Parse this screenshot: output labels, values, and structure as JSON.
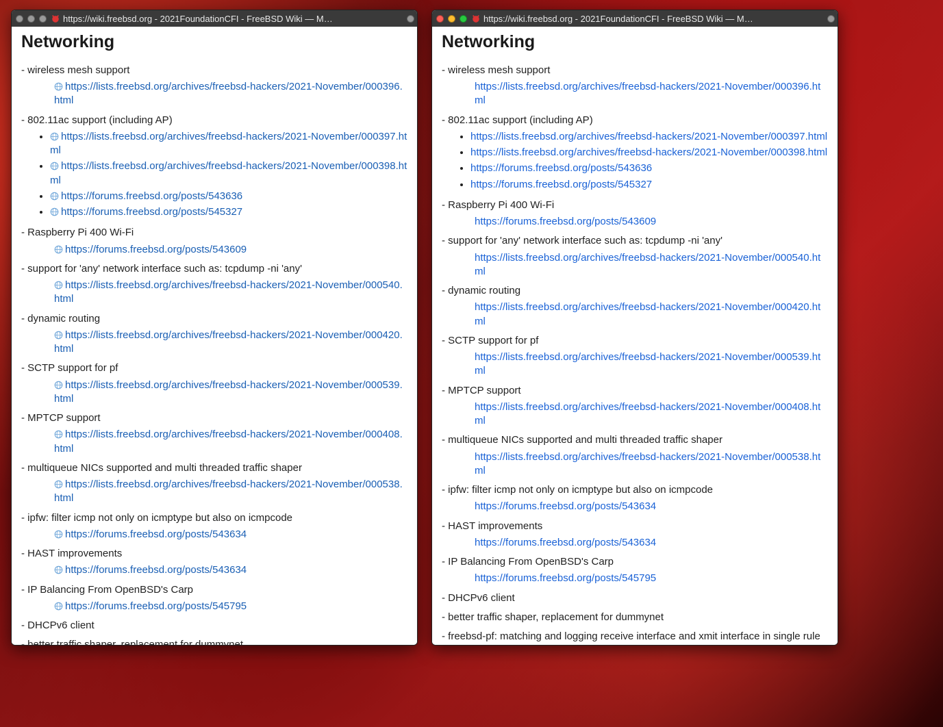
{
  "windows": {
    "left": {
      "title": "https://wiki.freebsd.org - 2021FoundationCFI - FreeBSD Wiki — M…"
    },
    "right": {
      "title": "https://wiki.freebsd.org - 2021FoundationCFI - FreeBSD Wiki — M…"
    }
  },
  "page": {
    "heading": "Networking",
    "items": [
      {
        "text": "- wireless mesh support",
        "links": [
          "https://lists.freebsd.org/archives/freebsd-hackers/2021-November/000396.html"
        ]
      },
      {
        "text": "- 802.11ac support (including AP)",
        "links": [
          "https://lists.freebsd.org/archives/freebsd-hackers/2021-November/000397.html",
          "https://lists.freebsd.org/archives/freebsd-hackers/2021-November/000398.html",
          "https://forums.freebsd.org/posts/543636",
          "https://forums.freebsd.org/posts/545327"
        ]
      },
      {
        "text": "- Raspberry Pi 400 Wi-Fi",
        "links": [
          "https://forums.freebsd.org/posts/543609"
        ]
      },
      {
        "text": "- support for 'any' network interface such as: tcpdump -ni 'any'",
        "links": [
          "https://lists.freebsd.org/archives/freebsd-hackers/2021-November/000540.html"
        ]
      },
      {
        "text": "- dynamic routing",
        "links": [
          "https://lists.freebsd.org/archives/freebsd-hackers/2021-November/000420.html"
        ]
      },
      {
        "text": "- SCTP support for pf",
        "links": [
          "https://lists.freebsd.org/archives/freebsd-hackers/2021-November/000539.html"
        ]
      },
      {
        "text": "- MPTCP support",
        "links": [
          "https://lists.freebsd.org/archives/freebsd-hackers/2021-November/000408.html"
        ]
      },
      {
        "text": "- multiqueue NICs supported and multi threaded traffic shaper",
        "links": [
          "https://lists.freebsd.org/archives/freebsd-hackers/2021-November/000538.html"
        ]
      },
      {
        "text": "- ipfw: filter icmp not only on icmptype but also on icmpcode",
        "links": [
          "https://forums.freebsd.org/posts/543634"
        ]
      },
      {
        "text": "- HAST improvements",
        "links": [
          "https://forums.freebsd.org/posts/543634"
        ]
      },
      {
        "text": "- IP Balancing From OpenBSD's Carp",
        "links": [
          "https://forums.freebsd.org/posts/545795"
        ]
      },
      {
        "text": "- DHCPv6 client",
        "links": []
      },
      {
        "text": "- better traffic shaper, replacement for dummynet",
        "links": []
      },
      {
        "text": "- freebsd-pf: matching and logging receive interface and xmit interface in single rule",
        "links": []
      }
    ]
  },
  "icons": {
    "globe": "globe-icon",
    "favicon": "freebsd-favicon"
  }
}
